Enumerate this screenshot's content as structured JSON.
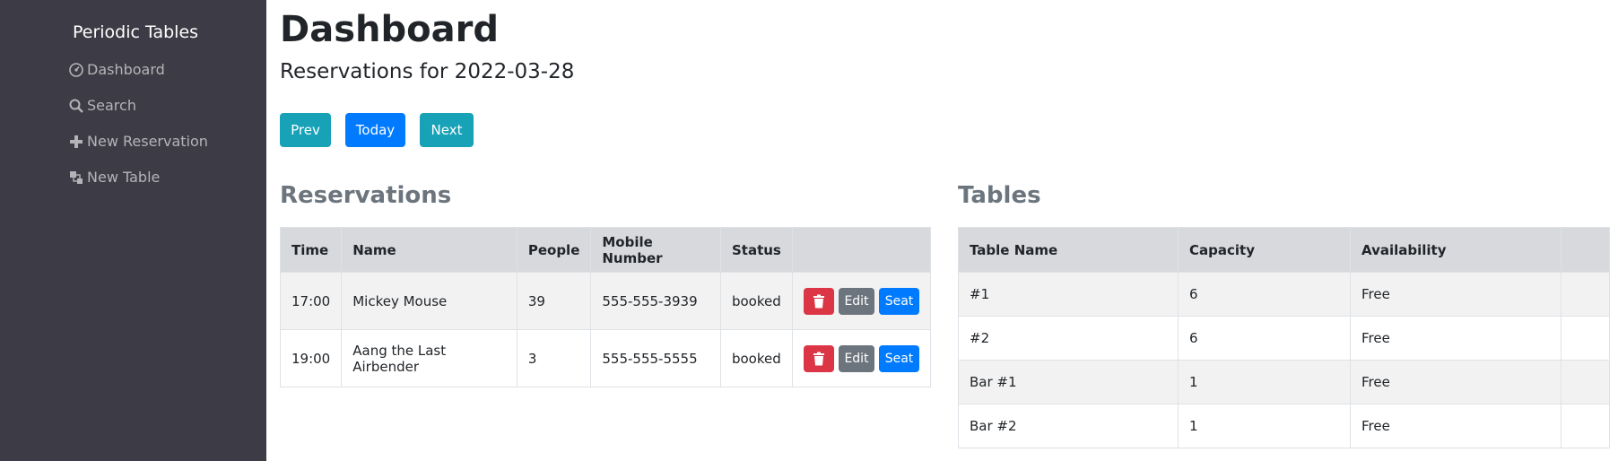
{
  "sidebar": {
    "brand": "Periodic Tables",
    "items": [
      {
        "label": "Dashboard",
        "icon": "dashboard-icon"
      },
      {
        "label": "Search",
        "icon": "search-icon"
      },
      {
        "label": "New Reservation",
        "icon": "plus-icon"
      },
      {
        "label": "New Table",
        "icon": "layers-icon"
      }
    ]
  },
  "header": {
    "title": "Dashboard",
    "subtitle": "Reservations for 2022-03-28"
  },
  "date_nav": {
    "prev": "Prev",
    "today": "Today",
    "next": "Next"
  },
  "reservations": {
    "title": "Reservations",
    "columns": [
      "Time",
      "Name",
      "People",
      "Mobile Number",
      "Status",
      ""
    ],
    "rows": [
      {
        "time": "17:00",
        "name": "Mickey Mouse",
        "people": "39",
        "mobile": "555-555-3939",
        "status": "booked"
      },
      {
        "time": "19:00",
        "name": "Aang the Last Airbender",
        "people": "3",
        "mobile": "555-555-5555",
        "status": "booked"
      }
    ],
    "actions": {
      "edit": "Edit",
      "seat": "Seat"
    }
  },
  "tables": {
    "title": "Tables",
    "columns": [
      "Table Name",
      "Capacity",
      "Availability",
      ""
    ],
    "rows": [
      {
        "name": "#1",
        "capacity": "6",
        "availability": "Free"
      },
      {
        "name": "#2",
        "capacity": "6",
        "availability": "Free"
      },
      {
        "name": "Bar #1",
        "capacity": "1",
        "availability": "Free"
      },
      {
        "name": "Bar #2",
        "capacity": "1",
        "availability": "Free"
      }
    ]
  },
  "colors": {
    "sidebar_bg": "#3d3c46",
    "info": "#17a2b8",
    "primary": "#007bff",
    "danger": "#dc3545",
    "secondary": "#6c757d"
  }
}
